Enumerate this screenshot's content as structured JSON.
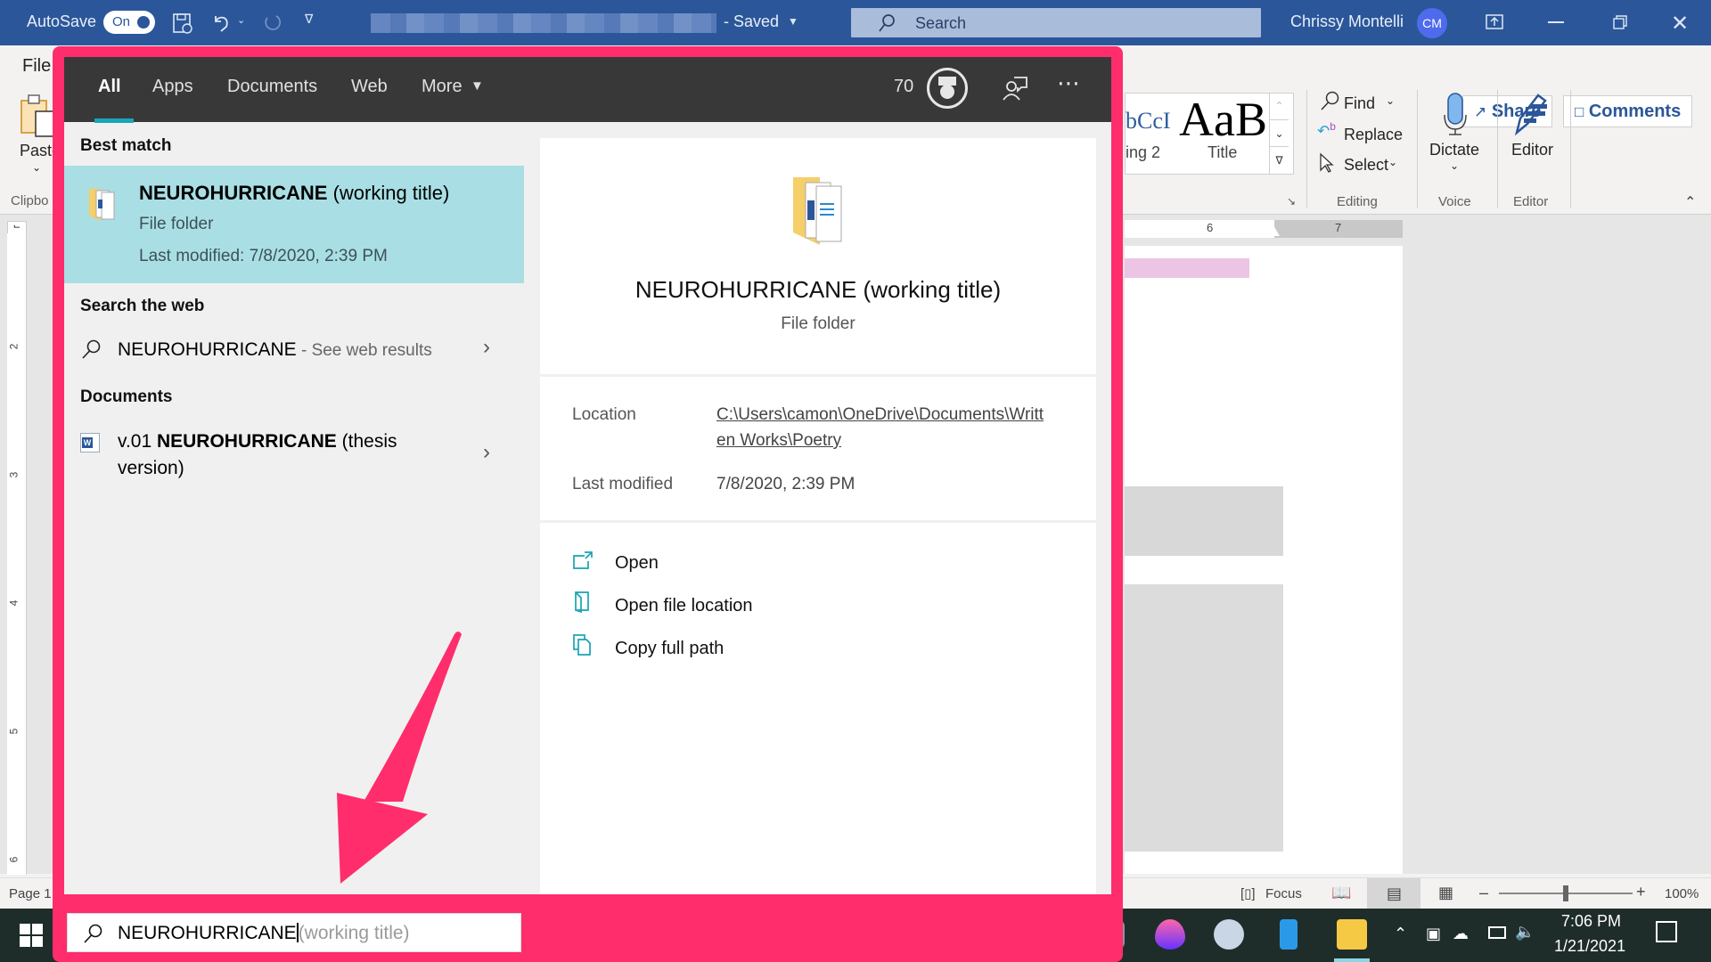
{
  "titlebar": {
    "autosave_label": "AutoSave",
    "autosave_state": "On",
    "doc_status": "- Saved",
    "search_placeholder": "Search",
    "user_name": "Chrissy Montelli",
    "user_initials": "CM"
  },
  "ribbon": {
    "file_tab": "File",
    "paste_label": "Paste",
    "clipboard_group": "Clipbo",
    "share_label": "Share",
    "comments_label": "Comments",
    "styles": [
      {
        "preview": "bCcI",
        "name": "ing 2"
      },
      {
        "preview": "AaB",
        "name": "Title"
      }
    ],
    "editing": {
      "find": "Find",
      "replace": "Replace",
      "select": "Select",
      "group": "Editing"
    },
    "voice": {
      "dictate": "Dictate",
      "group": "Voice"
    },
    "editor": {
      "label": "Editor",
      "group": "Editor"
    }
  },
  "ruler": {
    "h_ticks": [
      "6",
      "7"
    ],
    "v_ticks": [
      "2",
      "3",
      "4",
      "5",
      "6"
    ]
  },
  "statusbar": {
    "page": "Page 1",
    "focus": "Focus",
    "zoom": "100%",
    "zoom_fraction": 0.5
  },
  "search_flyout": {
    "tabs": [
      {
        "label": "All",
        "active": true
      },
      {
        "label": "Apps",
        "active": false
      },
      {
        "label": "Documents",
        "active": false
      },
      {
        "label": "Web",
        "active": false
      },
      {
        "label": "More",
        "active": false
      }
    ],
    "points": "70",
    "best_match": {
      "heading": "Best match",
      "title_bold": "NEUROHURRICANE",
      "title_rest": " (working title)",
      "type": "File folder",
      "modified": "Last modified: 7/8/2020, 2:39 PM"
    },
    "web": {
      "heading": "Search the web",
      "query": "NEUROHURRICANE",
      "suffix": " - See web results"
    },
    "documents": {
      "heading": "Documents",
      "items": [
        {
          "prefix": "v.01 ",
          "bold": "NEUROHURRICANE",
          "rest": " (thesis",
          "line2": "version)"
        }
      ]
    },
    "preview": {
      "title": "NEUROHURRICANE (working title)",
      "type": "File folder",
      "location_label": "Location",
      "location_line1": "C:\\Users\\camon\\OneDrive\\Documents\\Writt",
      "location_line2": "en Works\\Poetry",
      "modified_label": "Last modified",
      "modified_value": "7/8/2020, 2:39 PM",
      "actions": [
        "Open",
        "Open file location",
        "Copy full path"
      ]
    },
    "searchbox": {
      "typed": "NEUROHURRICANE",
      "suggestion": "(working title)"
    }
  },
  "taskbar": {
    "time": "7:06 PM",
    "date": "1/21/2021"
  },
  "annotation": {
    "color": "#ff2d6c"
  }
}
